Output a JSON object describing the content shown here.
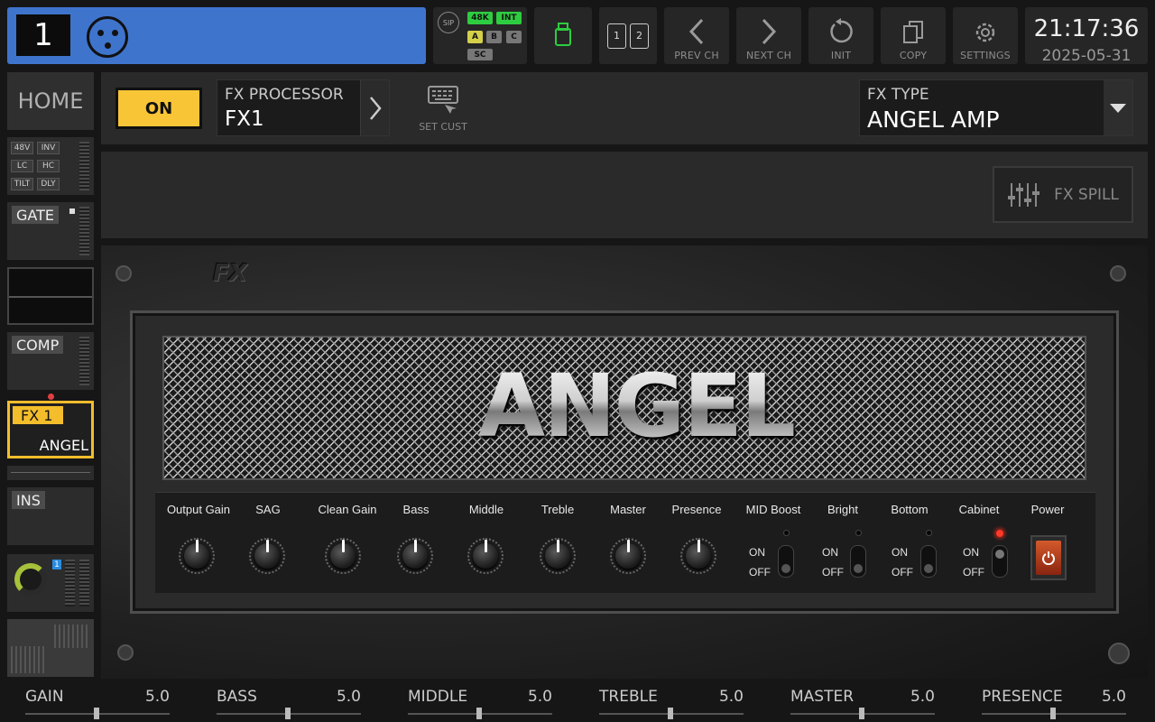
{
  "channel": {
    "number": "1"
  },
  "source": {
    "sip": "SIP",
    "rate": "48K",
    "clock": "INT",
    "inputs": [
      "A",
      "B",
      "C"
    ],
    "sc": "SC"
  },
  "topbar": {
    "prev": "PREV CH",
    "next": "NEXT CH",
    "init": "INIT",
    "copy": "COPY",
    "settings": "SETTINGS",
    "card_slots": [
      "1",
      "2"
    ]
  },
  "clock": {
    "time": "21:17:36",
    "date": "2025-05-31"
  },
  "sidebar": {
    "home": "HOME",
    "input_tags": [
      "48V",
      "INV",
      "LC",
      "HC",
      "TILT",
      "DLY"
    ],
    "gate": "GATE",
    "comp": "COMP",
    "fx_label": "FX 1",
    "fx_name": "ANGEL",
    "ins": "INS",
    "bus_num": "1"
  },
  "header": {
    "on": "ON",
    "proc_label": "FX PROCESSOR",
    "proc_value": "FX1",
    "set_cust": "SET CUST",
    "fx_type_label": "FX TYPE",
    "fx_type_value": "ANGEL AMP",
    "fx_spill": "FX SPILL"
  },
  "amp": {
    "badge": "FX",
    "brand": "ANGEL",
    "knobs": [
      "Output Gain",
      "SAG",
      "Clean Gain",
      "Bass",
      "Middle",
      "Treble",
      "Master",
      "Presence"
    ],
    "switches": [
      "MID Boost",
      "Bright",
      "Bottom",
      "Cabinet"
    ],
    "on": "ON",
    "off": "OFF",
    "power": "Power"
  },
  "params": [
    {
      "name": "GAIN",
      "value": "5.0"
    },
    {
      "name": "BASS",
      "value": "5.0"
    },
    {
      "name": "MIDDLE",
      "value": "5.0"
    },
    {
      "name": "TREBLE",
      "value": "5.0"
    },
    {
      "name": "MASTER",
      "value": "5.0"
    },
    {
      "name": "PRESENCE",
      "value": "5.0"
    }
  ],
  "colors": {
    "channel": "#3f74cd",
    "on": "#f8c536",
    "selected": "#f3bd2c",
    "active_green": "#2ecc40"
  }
}
